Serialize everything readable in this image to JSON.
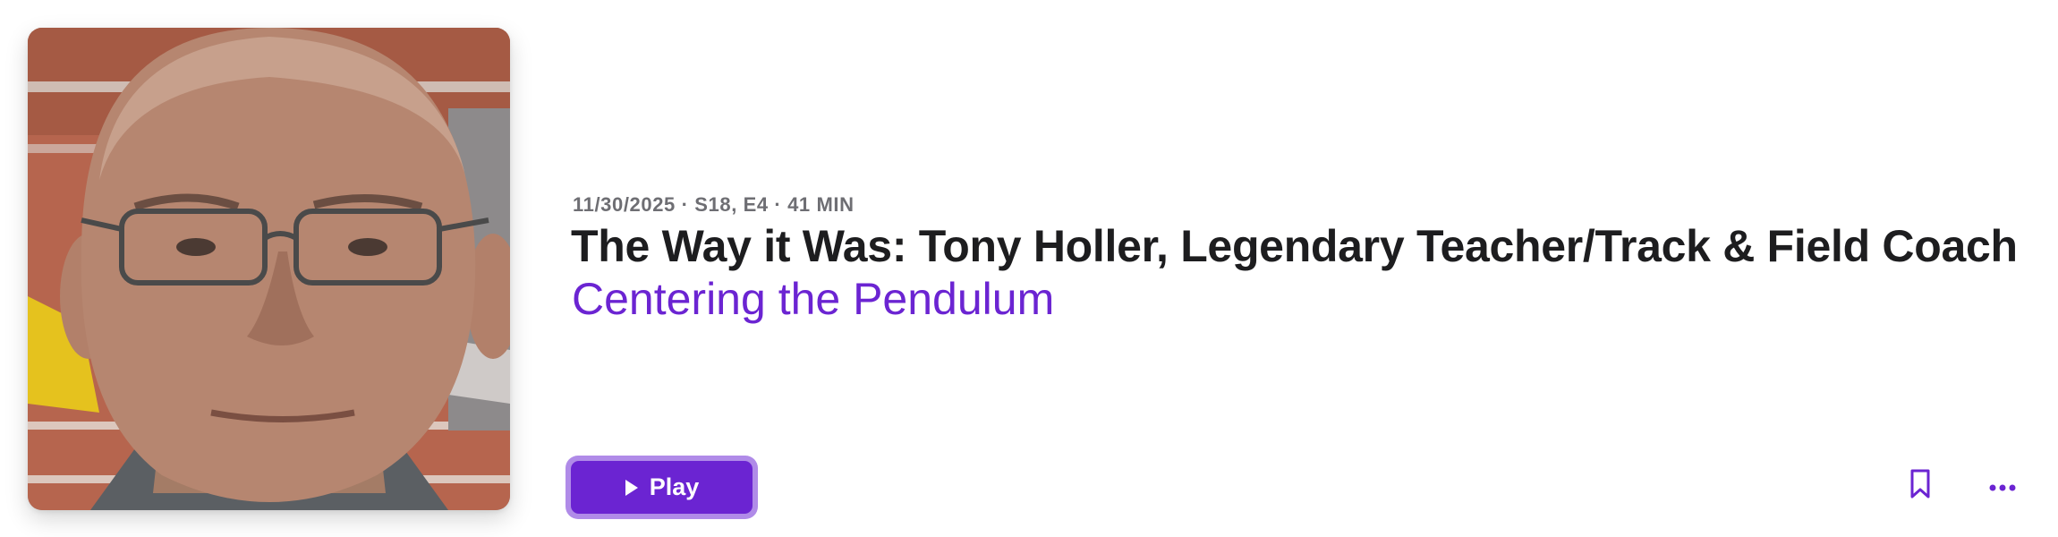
{
  "episode": {
    "meta": "11/30/2025 · S18, E4 · 41 MIN",
    "title": "The Way it Was: Tony Holler, Legendary Teacher/Track & Field Coach",
    "show_name": "Centering the Pendulum",
    "artwork_alt": "Tony Holler"
  },
  "actions": {
    "play_label": "Play",
    "play_icon": "play-icon",
    "bookmark_icon": "bookmark-icon",
    "more_icon": "more-icon"
  },
  "colors": {
    "accent": "#6b24d2",
    "accent_outline": "#b08be8",
    "meta_text": "#6e6e73",
    "title_text": "#1d1d1f"
  }
}
